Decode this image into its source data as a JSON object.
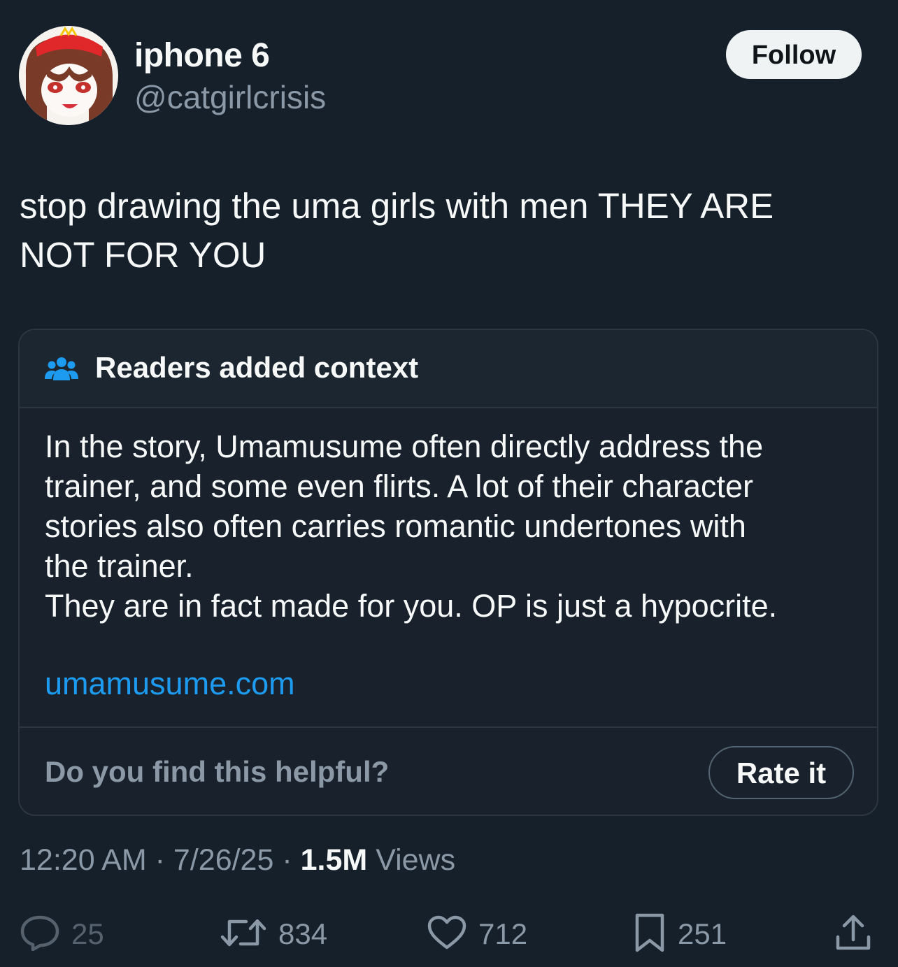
{
  "user": {
    "display_name": "iphone 6",
    "handle": "@catgirlcrisis",
    "avatar_icon": "anime-character-avatar"
  },
  "follow_label": "Follow",
  "tweet": {
    "text_line1": "stop drawing the uma girls with men THEY ARE",
    "text_line2": "NOT FOR YOU"
  },
  "note": {
    "title": "Readers added context",
    "icon": "people-icon",
    "body_lines": [
      "In the story, Umamusume often directly address the",
      "trainer, and some even flirts. A lot of their character",
      "stories also often carries romantic undertones with",
      "the trainer.",
      "They are in fact made for you. OP is just a hypocrite."
    ],
    "link": "umamusume.com",
    "helpful_prompt": "Do you find this helpful?",
    "rate_label": "Rate it"
  },
  "meta": {
    "time": "12:20 AM",
    "sep": "·",
    "date": "7/26/25",
    "views_count": "1.5M",
    "views_label": "Views"
  },
  "actions": {
    "replies": "25",
    "reposts": "834",
    "likes": "712",
    "bookmarks": "251"
  },
  "colors": {
    "background": "#15202b",
    "accent": "#1d9bf0",
    "secondary_text": "#8b98a5"
  }
}
